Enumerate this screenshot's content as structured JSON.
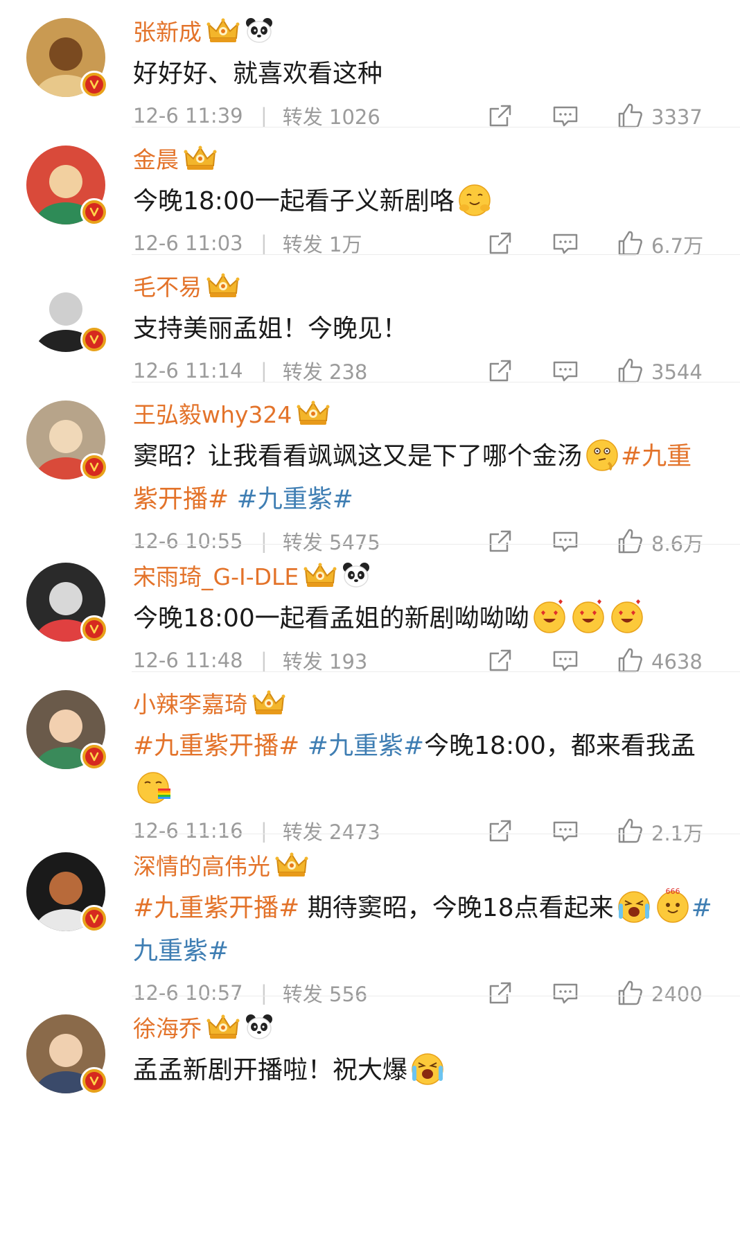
{
  "comments": [
    {
      "name": "张新成",
      "panda": true,
      "time": "12-6 11:39",
      "repost": "转发 1026",
      "likes": "3337",
      "body": [
        {
          "t": "text",
          "v": "好好好、就喜欢看这种"
        }
      ]
    },
    {
      "name": "金晨",
      "panda": false,
      "time": "12-6 11:03",
      "repost": "转发 1万",
      "likes": "6.7万",
      "body": [
        {
          "t": "text",
          "v": "今晚18:00一起看子义新剧咯"
        },
        {
          "t": "emoji",
          "name": "smiling-hands-emoji"
        }
      ]
    },
    {
      "name": "毛不易",
      "panda": false,
      "time": "12-6 11:14",
      "repost": "转发 238",
      "likes": "3544",
      "body": [
        {
          "t": "text",
          "v": "支持美丽孟姐！今晚见！"
        }
      ]
    },
    {
      "name": "王弘毅why324",
      "panda": false,
      "time": "12-6 10:55",
      "repost": "转发 5475",
      "likes": "8.6万",
      "body": [
        {
          "t": "text",
          "v": "窦昭？让我看看飒飒这又是下了哪个金汤"
        },
        {
          "t": "emoji",
          "name": "thinking-emoji"
        },
        {
          "t": "tag-o",
          "v": "#九重紫开播#"
        },
        {
          "t": "text",
          "v": " "
        },
        {
          "t": "tag-b",
          "v": "#九重紫#"
        }
      ]
    },
    {
      "name": "宋雨琦_G-I-DLE",
      "panda": true,
      "time": "12-6 11:48",
      "repost": "转发 193",
      "likes": "4638",
      "body": [
        {
          "t": "text",
          "v": "今晚18:00一起看孟姐的新剧呦呦呦"
        },
        {
          "t": "emoji",
          "name": "heart-eyes-emoji"
        },
        {
          "t": "emoji",
          "name": "heart-eyes-emoji"
        },
        {
          "t": "emoji",
          "name": "heart-eyes-emoji"
        }
      ]
    },
    {
      "name": "小辣李嘉琦",
      "panda": false,
      "time": "12-6 11:16",
      "repost": "转发 2473",
      "likes": "2.1万",
      "body": [
        {
          "t": "tag-o",
          "v": "#九重紫开播#"
        },
        {
          "t": "text",
          "v": " "
        },
        {
          "t": "tag-b",
          "v": "#九重紫#"
        },
        {
          "t": "text",
          "v": "今晚18:00，都来看我孟"
        },
        {
          "t": "emoji",
          "name": "rainbow-puke-emoji"
        }
      ]
    },
    {
      "name": "深情的高伟光",
      "panda": false,
      "time": "12-6 10:57",
      "repost": "转发 556",
      "likes": "2400",
      "body": [
        {
          "t": "tag-o",
          "v": "#九重紫开播#"
        },
        {
          "t": "text",
          "v": " 期待窦昭，今晚18点看起来"
        },
        {
          "t": "emoji",
          "name": "excited-tears-emoji"
        },
        {
          "t": "emoji",
          "name": "666-emoji"
        },
        {
          "t": "tag-b",
          "v": "#九重紫#"
        }
      ]
    },
    {
      "name": "徐海乔",
      "panda": true,
      "time": "",
      "repost": "",
      "likes": "",
      "body": [
        {
          "t": "text",
          "v": "孟孟新剧开播啦！祝大爆"
        },
        {
          "t": "emoji",
          "name": "excited-tears-emoji"
        }
      ]
    }
  ],
  "icons": {
    "share": "share-icon",
    "comment": "comment-icon",
    "like": "thumbs-up-icon",
    "verified": "verified-v-badge",
    "vip": "vip-crown-badge",
    "panda": "panda-badge"
  },
  "colors": {
    "name": "#e3732a",
    "tag_orange": "#e3732a",
    "tag_blue": "#3f7eb3",
    "meta": "#9b9b9b",
    "badge_gold": "#e8a21a",
    "badge_red": "#d6291f"
  }
}
